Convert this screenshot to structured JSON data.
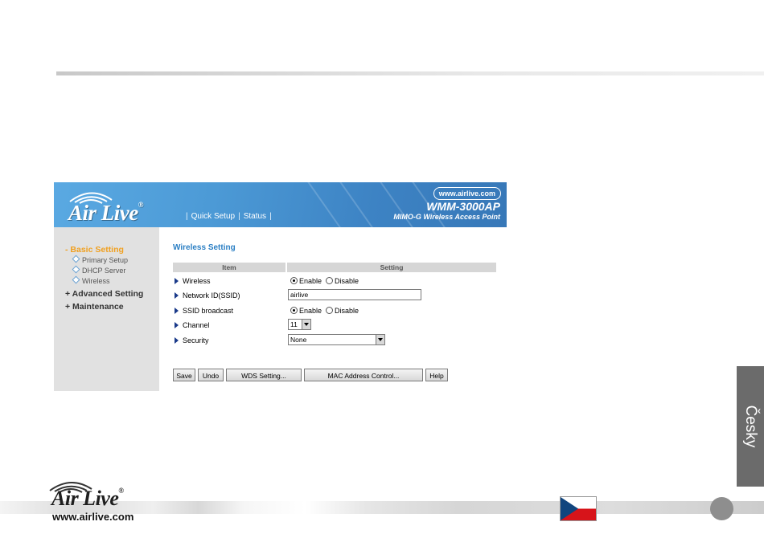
{
  "router": {
    "brand": "Air Live",
    "url_badge": "www.airlive.com",
    "model": "WMM-3000AP",
    "model_subtitle": "MIMO-G Wireless Access Point",
    "topnav": [
      "Quick Setup",
      "Status"
    ],
    "sidebar": {
      "sections": [
        {
          "label": "- Basic Setting",
          "active": true,
          "items": [
            "Primary Setup",
            "DHCP Server",
            "Wireless"
          ]
        },
        {
          "label": "+ Advanced Setting",
          "active": false,
          "items": []
        },
        {
          "label": "+ Maintenance",
          "active": false,
          "items": []
        }
      ]
    },
    "page_title": "Wireless Setting",
    "table_headers": [
      "Item",
      "Setting"
    ],
    "rows": {
      "wireless": {
        "label": "Wireless",
        "options": [
          "Enable",
          "Disable"
        ],
        "selected": "Enable"
      },
      "ssid": {
        "label": "Network ID(SSID)",
        "value": "airlive"
      },
      "broadcast": {
        "label": "SSID broadcast",
        "options": [
          "Enable",
          "Disable"
        ],
        "selected": "Enable"
      },
      "channel": {
        "label": "Channel",
        "value": "11"
      },
      "security": {
        "label": "Security",
        "value": "None"
      }
    },
    "buttons": [
      "Save",
      "Undo",
      "WDS Setting...",
      "MAC Address Control...",
      "Help"
    ]
  },
  "language_tab": "Česky",
  "footer": {
    "brand": "Air Live",
    "url": "www.airlive.com"
  },
  "colors": {
    "accent_blue": "#2b7fc4",
    "active_orange": "#f0a020",
    "tab_gray": "#6b6b6b"
  },
  "icons": {
    "row_marker": "triangle-right-icon",
    "sidebar_bullet": "diamond-icon"
  }
}
